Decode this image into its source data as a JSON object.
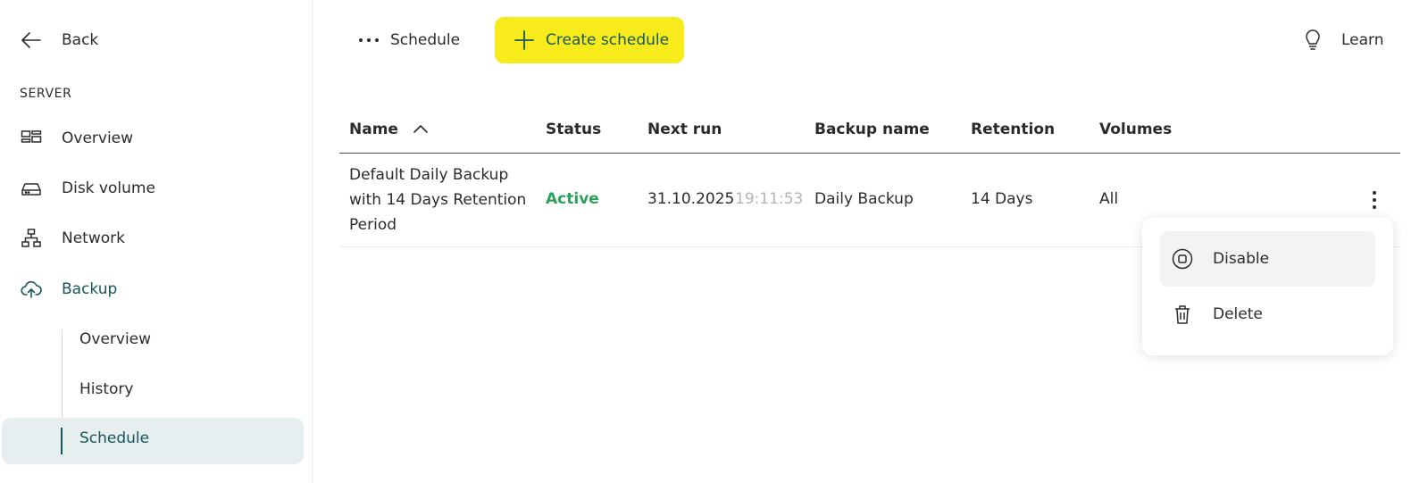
{
  "sidebar": {
    "back_label": "Back",
    "section_label": "SERVER",
    "items": [
      {
        "label": "Overview",
        "icon": "grid-icon"
      },
      {
        "label": "Disk volume",
        "icon": "disk-icon"
      },
      {
        "label": "Network",
        "icon": "network-icon"
      },
      {
        "label": "Backup",
        "icon": "cloud-upload-icon",
        "active": true
      }
    ],
    "backup_subitems": [
      {
        "label": "Overview"
      },
      {
        "label": "History"
      },
      {
        "label": "Schedule",
        "active": true
      }
    ]
  },
  "topbar": {
    "menu_label": "Schedule",
    "create_label": "Create schedule",
    "learn_label": "Learn"
  },
  "table": {
    "columns": [
      "Name",
      "Status",
      "Next run",
      "Backup name",
      "Retention",
      "Volumes"
    ],
    "sort_column": "Name",
    "sort_direction": "ascending",
    "rows": [
      {
        "name": "Default Daily Backup with 14 Days Retention Period",
        "status": "Active",
        "next_run_date": "31.10.2025",
        "next_run_time": "19:11:53",
        "backup_name": "Daily Backup",
        "retention": "14 Days",
        "volumes": "All"
      }
    ]
  },
  "context_menu": {
    "items": [
      {
        "label": "Disable",
        "icon": "stop-circle-icon"
      },
      {
        "label": "Delete",
        "icon": "trash-icon"
      }
    ]
  },
  "colors": {
    "accent": "#17575c",
    "primary_button": "#f8eb1c",
    "status_active": "#29a25a",
    "active_nav_bg": "#e6eeef",
    "muted_text": "#b5b5b5"
  }
}
